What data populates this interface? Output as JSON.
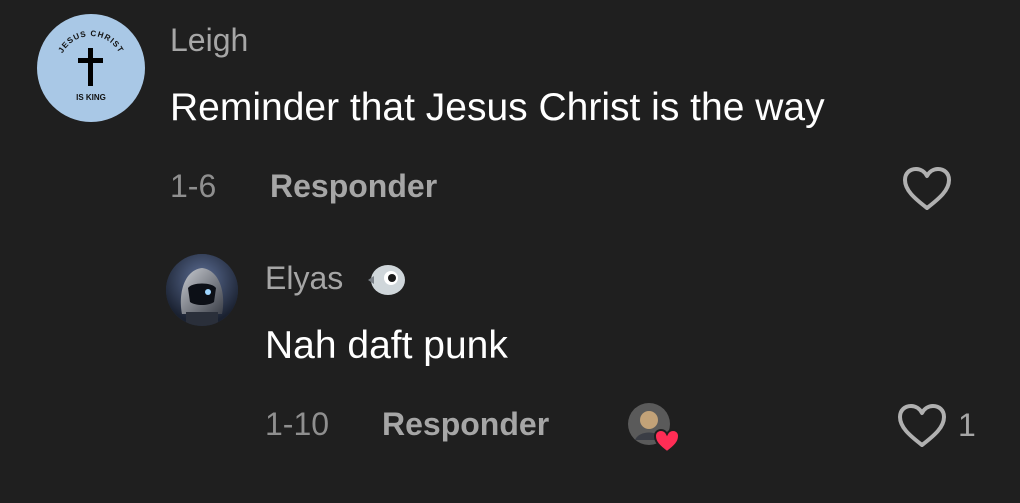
{
  "comment": {
    "username": "Leigh",
    "avatar_text_top": "JESUS CHRIST",
    "avatar_text_bottom": "IS KING",
    "text": "Reminder that Jesus Christ is the way",
    "date": "1-6",
    "reply_label": "Responder",
    "like_icon": "heart-outline-icon"
  },
  "reply": {
    "username": "Elyas",
    "username_emoji": "bird-emoji",
    "text": "Nah daft punk",
    "date": "1-10",
    "reply_label": "Responder",
    "like_icon": "heart-outline-icon",
    "like_count": "1",
    "creator_liked_icon": "red-heart-icon"
  },
  "colors": {
    "background": "#1f1f1f",
    "primary_text": "#ffffff",
    "secondary_text": "#a6a6a6",
    "avatar_bg": "#a9c8e6",
    "liked_heart": "#ff2d55"
  }
}
